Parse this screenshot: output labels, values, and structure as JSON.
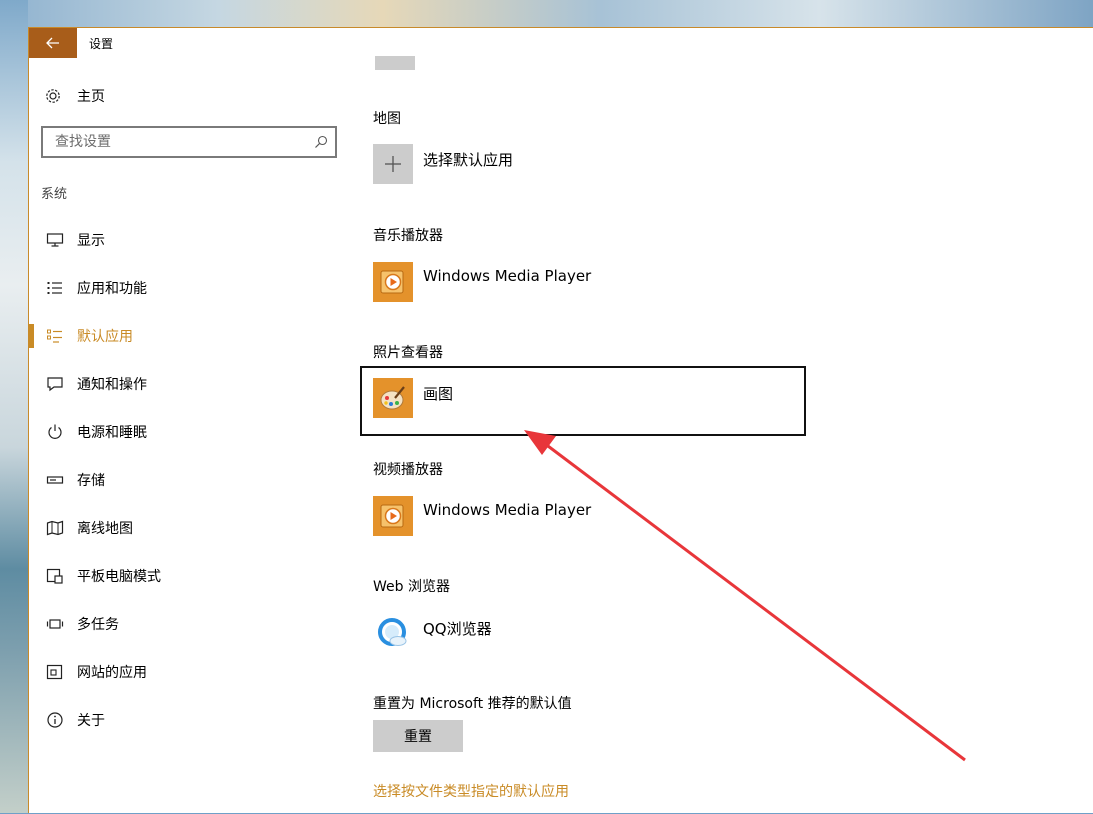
{
  "window": {
    "title": "设置"
  },
  "sidebar": {
    "home_label": "主页",
    "search_placeholder": "查找设置",
    "group_label": "系统",
    "items": [
      {
        "label": "显示",
        "icon": "monitor-icon",
        "active": false
      },
      {
        "label": "应用和功能",
        "icon": "apps-list-icon",
        "active": false
      },
      {
        "label": "默认应用",
        "icon": "default-apps-icon",
        "active": true
      },
      {
        "label": "通知和操作",
        "icon": "notification-icon",
        "active": false
      },
      {
        "label": "电源和睡眠",
        "icon": "power-icon",
        "active": false
      },
      {
        "label": "存储",
        "icon": "storage-icon",
        "active": false
      },
      {
        "label": "离线地图",
        "icon": "map-icon",
        "active": false
      },
      {
        "label": "平板电脑模式",
        "icon": "tablet-icon",
        "active": false
      },
      {
        "label": "多任务",
        "icon": "multitask-icon",
        "active": false
      },
      {
        "label": "网站的应用",
        "icon": "web-apps-icon",
        "active": false
      },
      {
        "label": "关于",
        "icon": "info-icon",
        "active": false
      }
    ]
  },
  "main": {
    "sections": [
      {
        "title": "地图",
        "app": "选择默认应用",
        "icon": "plus-icon"
      },
      {
        "title": "音乐播放器",
        "app": "Windows Media Player",
        "icon": "wmp-icon"
      },
      {
        "title": "照片查看器",
        "app": "画图",
        "icon": "paint-icon"
      },
      {
        "title": "视频播放器",
        "app": "Windows Media Player",
        "icon": "wmp-icon"
      },
      {
        "title": "Web 浏览器",
        "app": "QQ浏览器",
        "icon": "qq-browser-icon"
      }
    ],
    "reset_title": "重置为 Microsoft 推荐的默认值",
    "reset_button": "重置",
    "filetype_link": "选择按文件类型指定的默认应用"
  },
  "colors": {
    "accent": "#c98b26",
    "titlebar_back": "#a85d1a",
    "annotation_arrow": "#e8363a"
  }
}
